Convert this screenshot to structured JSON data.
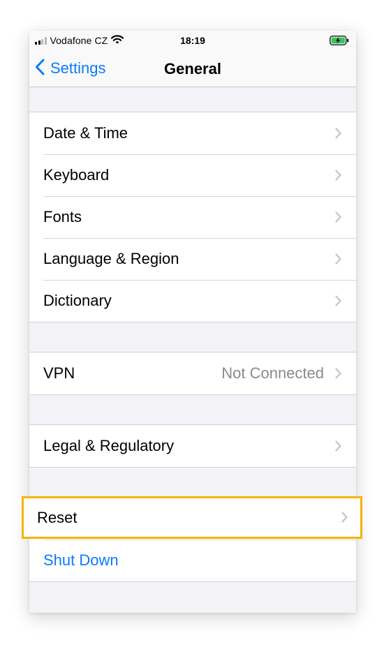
{
  "status_bar": {
    "carrier": "Vodafone CZ",
    "time": "18:19",
    "signal_bars": 4,
    "signal_bars_active": 2,
    "icons": [
      "signal-bars-icon",
      "wifi-icon",
      "battery-charging-icon"
    ]
  },
  "nav": {
    "back_label": "Settings",
    "title": "General",
    "back_icon": "chevron-left-icon"
  },
  "groups": [
    {
      "items": [
        {
          "label": "Date & Time",
          "value": ""
        },
        {
          "label": "Keyboard",
          "value": ""
        },
        {
          "label": "Fonts",
          "value": ""
        },
        {
          "label": "Language & Region",
          "value": ""
        },
        {
          "label": "Dictionary",
          "value": ""
        }
      ]
    },
    {
      "items": [
        {
          "label": "VPN",
          "value": "Not Connected"
        }
      ]
    },
    {
      "items": [
        {
          "label": "Legal & Regulatory",
          "value": ""
        }
      ]
    },
    {
      "items": [
        {
          "label": "Reset",
          "value": "",
          "highlighted": true
        },
        {
          "label": "Shut Down",
          "value": ""
        }
      ]
    }
  ],
  "colors": {
    "accent": "#0a7aff",
    "highlight_border": "#f5b400",
    "background": "#f2f2f7",
    "secondary_text": "#8a8a8e"
  }
}
